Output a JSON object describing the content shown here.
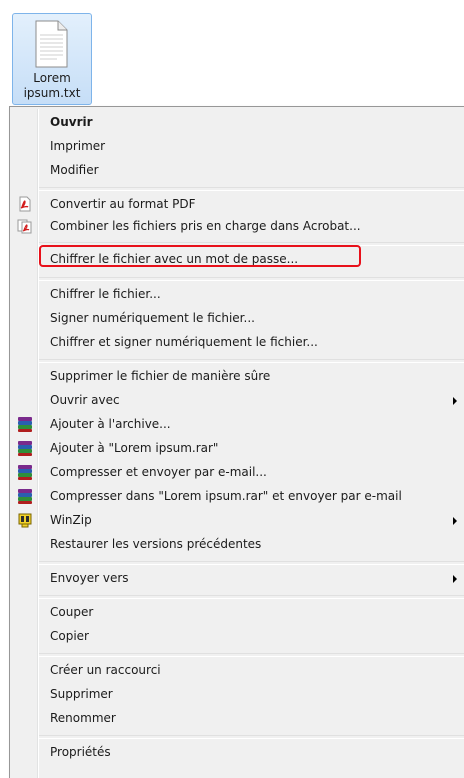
{
  "file": {
    "name_line1": "Lorem",
    "name_line2": "ipsum.txt",
    "icon": "text-file-icon"
  },
  "menu": {
    "items": [
      {
        "label": "Ouvrir",
        "bold": true
      },
      {
        "label": "Imprimer"
      },
      {
        "label": "Modifier"
      },
      {
        "label": "Convertir au format PDF",
        "icon": "acrobat-pdf-icon"
      },
      {
        "label": "Combiner les fichiers pris en charge dans Acrobat...",
        "icon": "acrobat-combine-icon"
      },
      {
        "label": "Chiffrer le fichier avec un mot de passe...",
        "highlighted": true
      },
      {
        "label": "Chiffrer le fichier..."
      },
      {
        "label": "Signer numériquement le fichier..."
      },
      {
        "label": "Chiffrer et signer numériquement le fichier..."
      },
      {
        "label": "Supprimer le fichier de manière sûre"
      },
      {
        "label": "Ouvrir avec",
        "submenu": true
      },
      {
        "label": "Ajouter à l'archive...",
        "icon": "winrar-icon"
      },
      {
        "label": "Ajouter à \"Lorem ipsum.rar\"",
        "icon": "winrar-icon"
      },
      {
        "label": "Compresser et envoyer par e-mail...",
        "icon": "winrar-icon"
      },
      {
        "label": "Compresser dans \"Lorem ipsum.rar\" et envoyer par e-mail",
        "icon": "winrar-icon"
      },
      {
        "label": "WinZip",
        "icon": "winzip-icon",
        "submenu": true
      },
      {
        "label": "Restaurer les versions précédentes"
      },
      {
        "label": "Envoyer vers",
        "submenu": true
      },
      {
        "label": "Couper"
      },
      {
        "label": "Copier"
      },
      {
        "label": "Créer un raccourci"
      },
      {
        "label": "Supprimer"
      },
      {
        "label": "Renommer"
      },
      {
        "label": "Propriétés"
      }
    ]
  },
  "colors": {
    "menu_background": "#f0f0f0",
    "highlight_border": "#e8101a",
    "selection_tile": "#c6def7"
  }
}
